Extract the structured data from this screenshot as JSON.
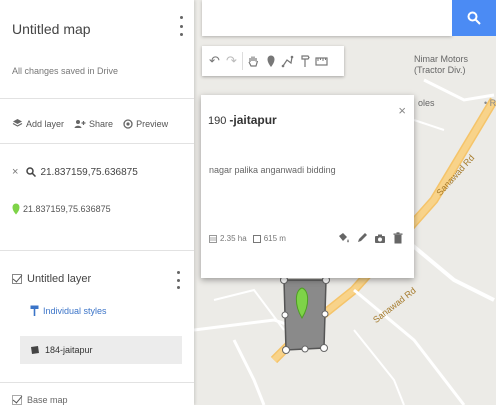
{
  "sidebar": {
    "title": "Untitled map",
    "saved_status": "All changes saved in Drive",
    "actions": {
      "add_layer": "Add layer",
      "share": "Share",
      "preview": "Preview"
    },
    "search": {
      "close_glyph": "×",
      "query": "21.837159,75.636875"
    },
    "location": {
      "label": "21.837159,75.636875"
    },
    "layer": {
      "name": "Untitled layer",
      "styles_label": "Individual styles",
      "feature_label": "184-jaitapur"
    },
    "base_map_label": "Base map"
  },
  "map": {
    "labels": {
      "business": "Nimar Motors\n(Tractor Div.)",
      "road": "Sanawad Rd",
      "partial": "oles"
    },
    "colors": {
      "search_button": "#4b8bf4",
      "pin": "#7ed348",
      "polygon": "#8a8a8a"
    }
  },
  "popup": {
    "number": "190",
    "title": "-jaitapur",
    "description": "nagar palika anganwadi bidding",
    "area": "2.35 ha",
    "perimeter": "615 m",
    "close_glyph": "×"
  },
  "icons": [
    "search-icon",
    "undo-icon",
    "redo-icon",
    "hand-icon",
    "marker-icon",
    "draw-line-icon",
    "directions-icon",
    "ruler-icon",
    "layers-icon",
    "share-icon",
    "preview-icon",
    "pin-icon",
    "paint-icon",
    "edit-icon",
    "camera-icon",
    "trash-icon"
  ]
}
